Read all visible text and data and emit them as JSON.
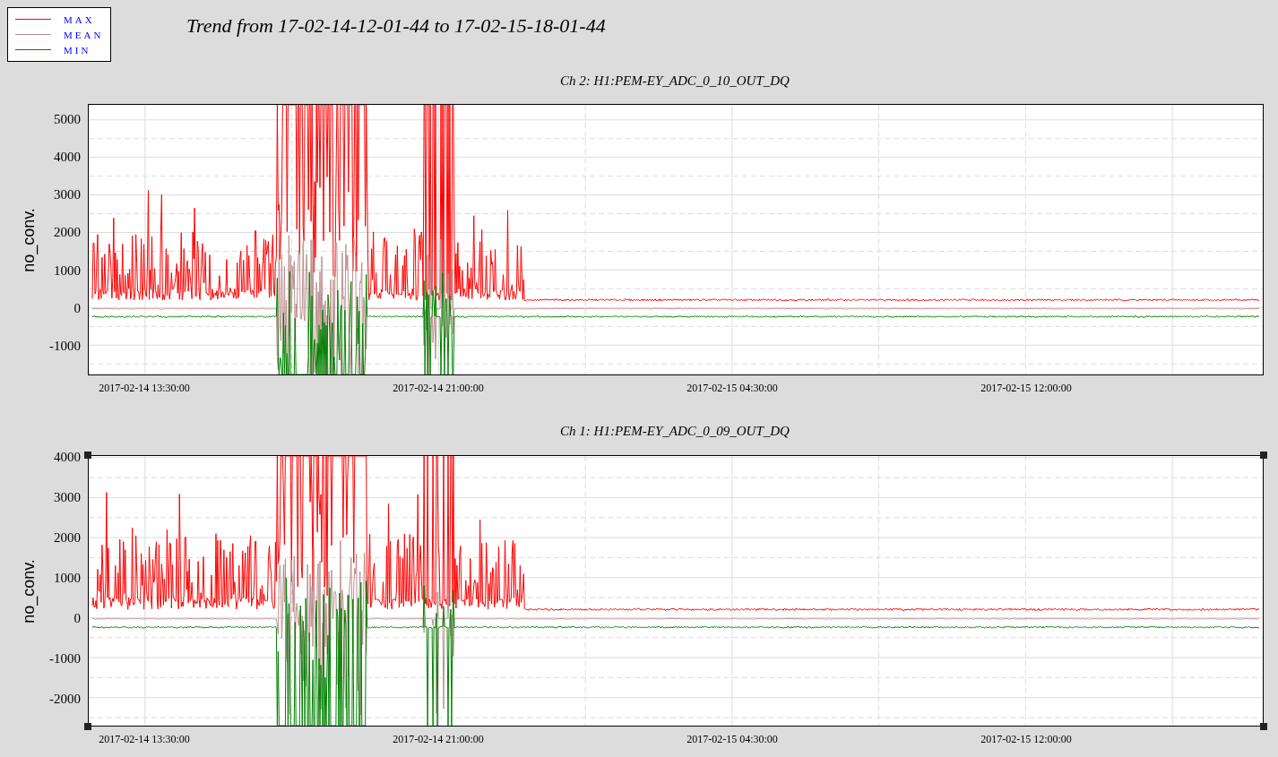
{
  "legend": [
    {
      "label": "MAX",
      "color": "#ff0000"
    },
    {
      "label": "MEAN",
      "color": "#bc8f8f"
    },
    {
      "label": "MIN",
      "color": "#008000"
    }
  ],
  "title": "Trend from 17-02-14-12-01-44 to 17-02-15-18-01-44",
  "panels": [
    {
      "title": "Ch 2: H1:PEM-EY_ADC_0_10_OUT_DQ",
      "ylabel": "no_conv.",
      "selected": false,
      "yticks": [
        "5000",
        "4000",
        "3000",
        "2000",
        "1000",
        "0",
        "-1000"
      ],
      "xticks": [
        "2017-02-14 13:30:00",
        "2017-02-14 21:00:00",
        "2017-02-15 04:30:00",
        "2017-02-15 12:00:00"
      ]
    },
    {
      "title": "Ch 1: H1:PEM-EY_ADC_0_09_OUT_DQ",
      "ylabel": "no_conv.",
      "selected": true,
      "yticks": [
        "4000",
        "3000",
        "2000",
        "1000",
        "0",
        "-1000",
        "-2000"
      ],
      "xticks": [
        "2017-02-14 13:30:00",
        "2017-02-14 21:00:00",
        "2017-02-15 04:30:00",
        "2017-02-15 12:00:00"
      ]
    }
  ]
}
